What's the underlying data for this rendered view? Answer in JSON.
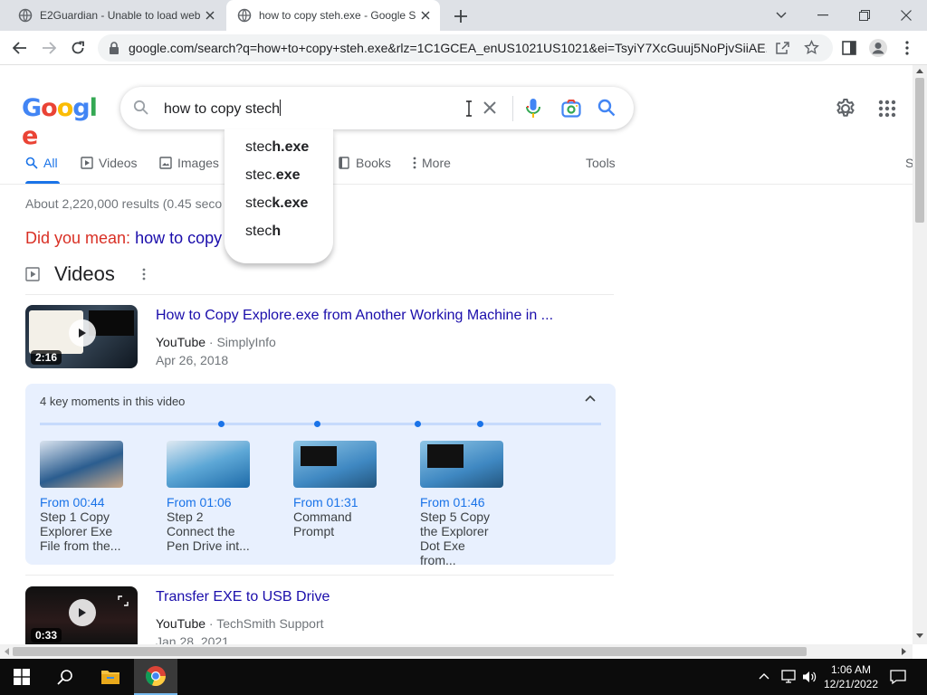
{
  "browser": {
    "tabs": [
      {
        "title": "E2Guardian - Unable to load web",
        "active": false
      },
      {
        "title": "how to copy steh.exe - Google S",
        "active": true
      }
    ],
    "url": "google.com/search?q=how+to+copy+steh.exe&rlz=1C1GCEA_enUS1021US1021&ei=TsyiY7XcGuuj5NoPjvSiiAE..."
  },
  "search": {
    "query": "how to copy stech",
    "suggestions": [
      {
        "prefix": "stec",
        "bold": "h.exe"
      },
      {
        "prefix": "stec.",
        "bold": "exe"
      },
      {
        "prefix": "stec",
        "bold": "k.exe"
      },
      {
        "prefix": "stec",
        "bold": "h"
      }
    ]
  },
  "nav_tabs": [
    "All",
    "Videos",
    "Images",
    "Books",
    "More",
    "Tools",
    "S"
  ],
  "results": {
    "stats": "About 2,220,000 results (0.45 seco",
    "did_you_mean_label": "Did you mean:",
    "did_you_mean_link": "how to copy",
    "videos_heading": "Videos",
    "videos": [
      {
        "title": "How to Copy Explore.exe from Another Working Machine in ...",
        "source": "YouTube",
        "channel": "SimplyInfo",
        "date": "Apr 26, 2018",
        "duration": "2:16"
      },
      {
        "title": "Transfer EXE to USB Drive",
        "source": "YouTube",
        "channel": "TechSmith Support",
        "date": "Jan 28, 2021",
        "duration": "0:33"
      }
    ],
    "key_moments": {
      "heading": "4 key moments in this video",
      "items": [
        {
          "time": "From 00:44",
          "text": "Step 1 Copy Explorer Exe File from the..."
        },
        {
          "time": "From 01:06",
          "text": "Step 2 Connect the Pen Drive int..."
        },
        {
          "time": "From 01:31",
          "text": "Command Prompt"
        },
        {
          "time": "From 01:46",
          "text": "Step 5 Copy the Explorer Dot Exe from..."
        }
      ]
    }
  },
  "taskbar": {
    "time": "1:06 AM",
    "date": "12/21/2022"
  },
  "colors": {
    "link": "#1a0dab",
    "accent": "#1a73e8",
    "dym_red": "#d93025"
  }
}
